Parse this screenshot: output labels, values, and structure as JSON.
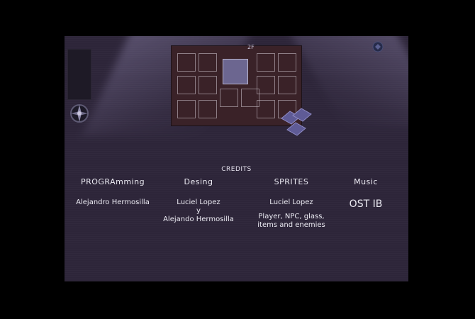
{
  "credits": {
    "title": "CREDITS",
    "columns": [
      {
        "heading": "PROGRAmming",
        "lines": [
          "Alejandro Hermosilla"
        ]
      },
      {
        "heading": "Desing",
        "lines": [
          "Luciel Lopez",
          "y",
          "Alejando Hermosilla"
        ]
      },
      {
        "heading": "SPRITES",
        "lines": [
          "Luciel Lopez",
          "",
          "Player, NPC, glass,",
          "items and enemies"
        ]
      },
      {
        "heading": "Music",
        "lines": [
          "OST IB"
        ]
      }
    ]
  },
  "scene": {
    "room_label": "2F",
    "icons": [
      "compass-icon",
      "orb-icon",
      "pillow-icon"
    ]
  },
  "colors": {
    "background": "#000000",
    "stage": "#2d2539",
    "text": "#ecebf3",
    "rug": "#3a2228",
    "bed": "#6c6690"
  }
}
